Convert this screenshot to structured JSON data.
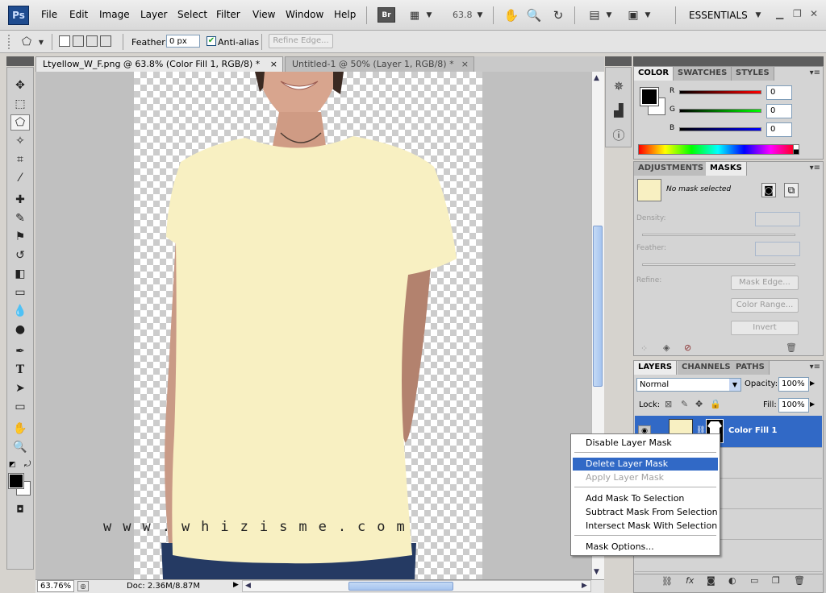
{
  "app": {
    "logo_text": "Ps",
    "bridge_text": "Br",
    "zoom_value": "63.8",
    "workspace": "ESSENTIALS"
  },
  "menu": [
    "File",
    "Edit",
    "Image",
    "Layer",
    "Select",
    "Filter",
    "View",
    "Window",
    "Help"
  ],
  "options": {
    "feather_label": "Feather:",
    "feather_value": "0 px",
    "antialias_label": "Anti-alias",
    "antialias_checked": true,
    "refine_edge_label": "Refine Edge..."
  },
  "tabs": [
    {
      "label": "Ltyellow_W_F.png @ 63.8% (Color Fill 1, RGB/8) *",
      "close": "×"
    },
    {
      "label": "Untitled-1 @ 50% (Layer 1, RGB/8) *",
      "close": "×"
    }
  ],
  "canvas": {
    "watermark": "www.whizisme.com",
    "shirt_color": "#f8f0c2",
    "skin_color": "#c99a86",
    "jeans_color": "#253a63"
  },
  "status": {
    "zoom": "63.76%",
    "doc_info": "Doc: 2.36M/8.87M"
  },
  "color_panel": {
    "tabs": [
      "COLOR",
      "SWATCHES",
      "STYLES"
    ],
    "channels": [
      {
        "label": "R",
        "value": "0"
      },
      {
        "label": "G",
        "value": "0"
      },
      {
        "label": "B",
        "value": "0"
      }
    ]
  },
  "masks_panel": {
    "tabs": [
      "ADJUSTMENTS",
      "MASKS"
    ],
    "no_mask_text": "No mask selected",
    "density_label": "Density:",
    "feather_label": "Feather:",
    "refine_label": "Refine:",
    "buttons": [
      "Mask Edge...",
      "Color Range...",
      "Invert"
    ]
  },
  "layers_panel": {
    "tabs": [
      "LAYERS",
      "CHANNELS",
      "PATHS"
    ],
    "blend_mode": "Normal",
    "opacity_label": "Opacity:",
    "opacity_value": "100%",
    "lock_label": "Lock:",
    "fill_label": "Fill:",
    "fill_value": "100%",
    "layers": [
      {
        "name": "Color Fill 1",
        "selected": true
      }
    ]
  },
  "context_menu": {
    "items": [
      {
        "label": "Disable Layer Mask",
        "state": "normal"
      },
      {
        "label": "Delete Layer Mask",
        "state": "highlighted"
      },
      {
        "label": "Apply Layer Mask",
        "state": "disabled"
      },
      {
        "label": "Add Mask To Selection",
        "state": "normal"
      },
      {
        "label": "Subtract Mask From Selection",
        "state": "normal"
      },
      {
        "label": "Intersect Mask With Selection",
        "state": "normal"
      },
      {
        "label": "Mask Options...",
        "state": "normal"
      }
    ]
  },
  "colors": {
    "accent": "#3169c6",
    "foreground": "#000000",
    "background": "#ffffff"
  }
}
